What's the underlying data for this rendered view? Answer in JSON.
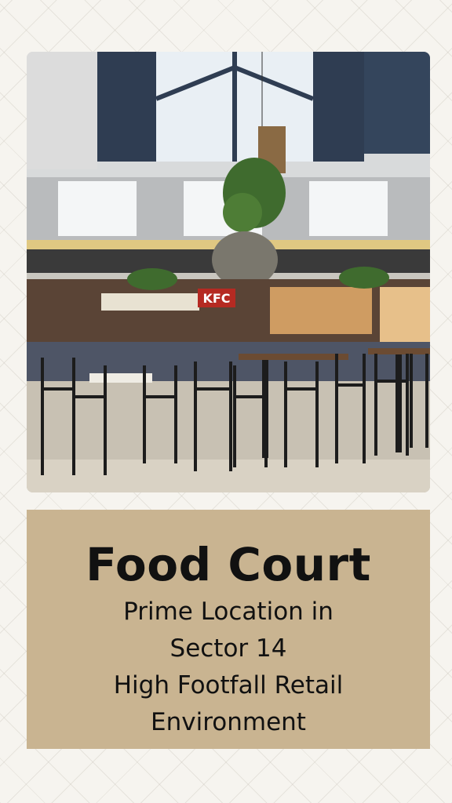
{
  "photo": {
    "description_icon": "food-court-photo",
    "sign_text": "KFC"
  },
  "card": {
    "title": "Food Court",
    "lines": [
      "Prime Location in",
      "Sector 14",
      "High Footfall Retail",
      "Environment"
    ],
    "background": "#c9b491"
  }
}
